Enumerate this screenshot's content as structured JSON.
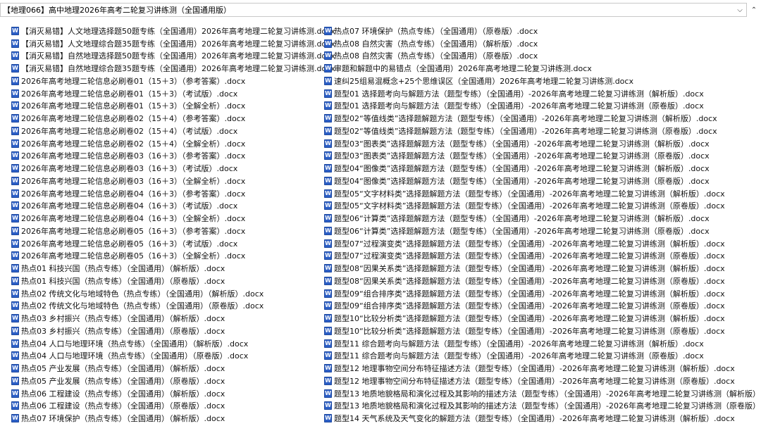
{
  "window": {
    "title": "【地理066】高中地理2026年高考二轮复习讲练测（全国通用版）"
  },
  "icons": {
    "file_icon": "word-doc-icon",
    "file_icon_glyph": "W",
    "file_icon_color": "#2b5ec6",
    "dropdown_glyph": "⌵",
    "scroll_up_glyph": "⌃"
  },
  "files_left": [
    "【消灭易错】人文地理选择题50题专练（全国通用）2026年高考地理二轮复习讲练测.docx",
    "【消灭易错】人文地理综合题35题专练（全国通用）2026年高考地理二轮复习讲练测.docx",
    "【消灭易错】自然地理选择题50题专练（全国通用）2026年高考地理二轮复习讲练测.docx",
    "【消灭易错】自然地理综合题35题专练（全国通用）2026年高考地理二轮复习讲练测.docx",
    "2026年高考地理二轮信息必刷卷01（15＋3）（参考答案）.docx",
    "2026年高考地理二轮信息必刷卷01（15＋3）（考试版）.docx",
    "2026年高考地理二轮信息必刷卷01（15＋3）（全解全析）.docx",
    "2026年高考地理二轮信息必刷卷02（15＋4）（参考答案）.docx",
    "2026年高考地理二轮信息必刷卷02（15＋4）（考试版）.docx",
    "2026年高考地理二轮信息必刷卷02（15＋4）（全解全析）.docx",
    "2026年高考地理二轮信息必刷卷03（16＋3）（参考答案）.docx",
    "2026年高考地理二轮信息必刷卷03（16＋3）（考试版）.docx",
    "2026年高考地理二轮信息必刷卷03（16＋3）（全解全析）.docx",
    "2026年高考地理二轮信息必刷卷04（16＋3）（参考答案）.docx",
    "2026年高考地理二轮信息必刷卷04（16＋3）（考试版）.docx",
    "2026年高考地理二轮信息必刷卷04（16＋3）（全解全析）.docx",
    "2026年高考地理二轮信息必刷卷05（16＋3）（参考答案）.docx",
    "2026年高考地理二轮信息必刷卷05（16＋3）（考试版）.docx",
    "2026年高考地理二轮信息必刷卷05（16＋3）（全解全析）.docx",
    "热点01 科技兴国（热点专练）（全国通用）（解析版）.docx",
    "热点01 科技兴国（热点专练）（全国通用）（原卷版）.docx",
    "热点02 传统文化与地域特色（热点专练）（全国通用）（解析版）.docx",
    "热点02 传统文化与地域特色（热点专练）（全国通用）（原卷版）.docx",
    "热点03 乡村振兴（热点专练）（全国通用）（解析版）.docx",
    "热点03 乡村振兴（热点专练）（全国通用）（原卷版）.docx",
    "热点04 人口与地理环境（热点专练）（全国通用）（解析版）.docx",
    "热点04 人口与地理环境（热点专练）（全国通用）（原卷版）.docx",
    "热点05 产业发展（热点专练）（全国通用）（解析版）.docx",
    "热点05 产业发展（热点专练）（全国通用）（原卷版）.docx",
    "热点06 工程建设（热点专练）（全国通用）（解析版）.docx",
    "热点06 工程建设（热点专练）（全国通用）（原卷版）.docx",
    "热点07 环境保护（热点专练）（全国通用）（解析版）.docx"
  ],
  "files_right": [
    "热点07 环境保护（热点专练）（全国通用）（原卷版）.docx",
    "热点08 自然灾害（热点专练）（全国通用）（解析版）.docx",
    "热点08 自然灾害（热点专练）（全国通用）（原卷版）.docx",
    "审题和解题中的易错点（全国通用）2026年高考地理二轮复习讲练测.docx",
    "速纠25组易混概念+25个思维误区（全国通用）2026年高考地理二轮复习讲练测.docx",
    "题型01 选择题考向与解题方法（题型专练）（全国通用）-2026年高考地理二轮复习讲练测（解析版）.docx",
    "题型01 选择题考向与解题方法（题型专练）（全国通用）-2026年高考地理二轮复习讲练测（原卷版）.docx",
    "题型02“等值线类”选择题解题方法（题型专练）（全国通用）-2026年高考地理二轮复习讲练测（解析版）.docx",
    "题型02“等值线类”选择题解题方法（题型专练）（全国通用）-2026年高考地理二轮复习讲练测（原卷版）.docx",
    "题型03“图表类”选择题解题方法（题型专练）（全国通用）-2026年高考地理二轮复习讲练测（解析版）.docx",
    "题型03“图表类”选择题解题方法（题型专练）（全国通用）-2026年高考地理二轮复习讲练测（原卷版）.docx",
    "题型04“图像类”选择题解题方法（题型专练）（全国通用）-2026年高考地理二轮复习讲练测（解析版）.docx",
    "题型04“图像类”选择题解题方法（题型专练）（全国通用）-2026年高考地理二轮复习讲练测（原卷版）.docx",
    "题型05“文字材料类”选择题解题方法（题型专练）（全国通用）-2026年高考地理二轮复习讲练测（解析版）.docx",
    "题型05“文字材料类”选择题解题方法（题型专练）（全国通用）-2026年高考地理二轮复习讲练测（原卷版）.docx",
    "题型06“计算类”选择题解题方法（题型专练）（全国通用）-2026年高考地理二轮复习讲练测（解析版）.docx",
    "题型06“计算类”选择题解题方法（题型专练）（全国通用）-2026年高考地理二轮复习讲练测（原卷版）.docx",
    "题型07“过程演变类”选择题解题方法（题型专练）（全国通用）-2026年高考地理二轮复习讲练测（解析版）.docx",
    "题型07“过程演变类”选择题解题方法（题型专练）（全国通用）-2026年高考地理二轮复习讲练测（原卷版）.docx",
    "题型08“因果关系类”选择题解题方法（题型专练）（全国通用）-2026年高考地理二轮复习讲练测（解析版）.docx",
    "题型08“因果关系类”选择题解题方法（题型专练）（全国通用）-2026年高考地理二轮复习讲练测（原卷版）.docx",
    "题型09“组合排序类”选择题解题方法（题型专练）（全国通用）-2026年高考地理二轮复习讲练测（解析版）.docx",
    "题型09“组合排序类”选择题解题方法（题型专练）（全国通用）-2026年高考地理二轮复习讲练测（原卷版）.docx",
    "题型10“比较分析类”选择题解题方法（题型专练）（全国通用）-2026年高考地理二轮复习讲练测（解析版）.docx",
    "题型10“比较分析类”选择题解题方法（题型专练）（全国通用）-2026年高考地理二轮复习讲练测（原卷版）.docx",
    "题型11 综合题考向与解题方法（题型专练）（全国通用）-2026年高考地理二轮复习讲练测（解析版）.docx",
    "题型11 综合题考向与解题方法（题型专练）（全国通用）-2026年高考地理二轮复习讲练测（原卷版）.docx",
    "题型12 地理事物空间分布特征描述方法（题型专练）（全国通用）-2026年高考地理二轮复习讲练测（解析版）.docx",
    "题型12 地理事物空间分布特征描述方法（题型专练）（全国通用）-2026年高考地理二轮复习讲练测（原卷版）.docx",
    "题型13 地质地貌格局和演化过程及其影响的描述方法（题型专练）（全国通用）-2026年高考地理二轮复习讲练测（解析版）.docx",
    "题型13 地质地貌格局和演化过程及其影响的描述方法（题型专练）（全国通用）-2026年高考地理二轮复习讲练测（原卷版）.docx",
    "题型14 天气系统及天气变化的解题方法（题型专练）（全国通用）-2026年高考地理二轮复习讲练测（解析版）.docx"
  ]
}
